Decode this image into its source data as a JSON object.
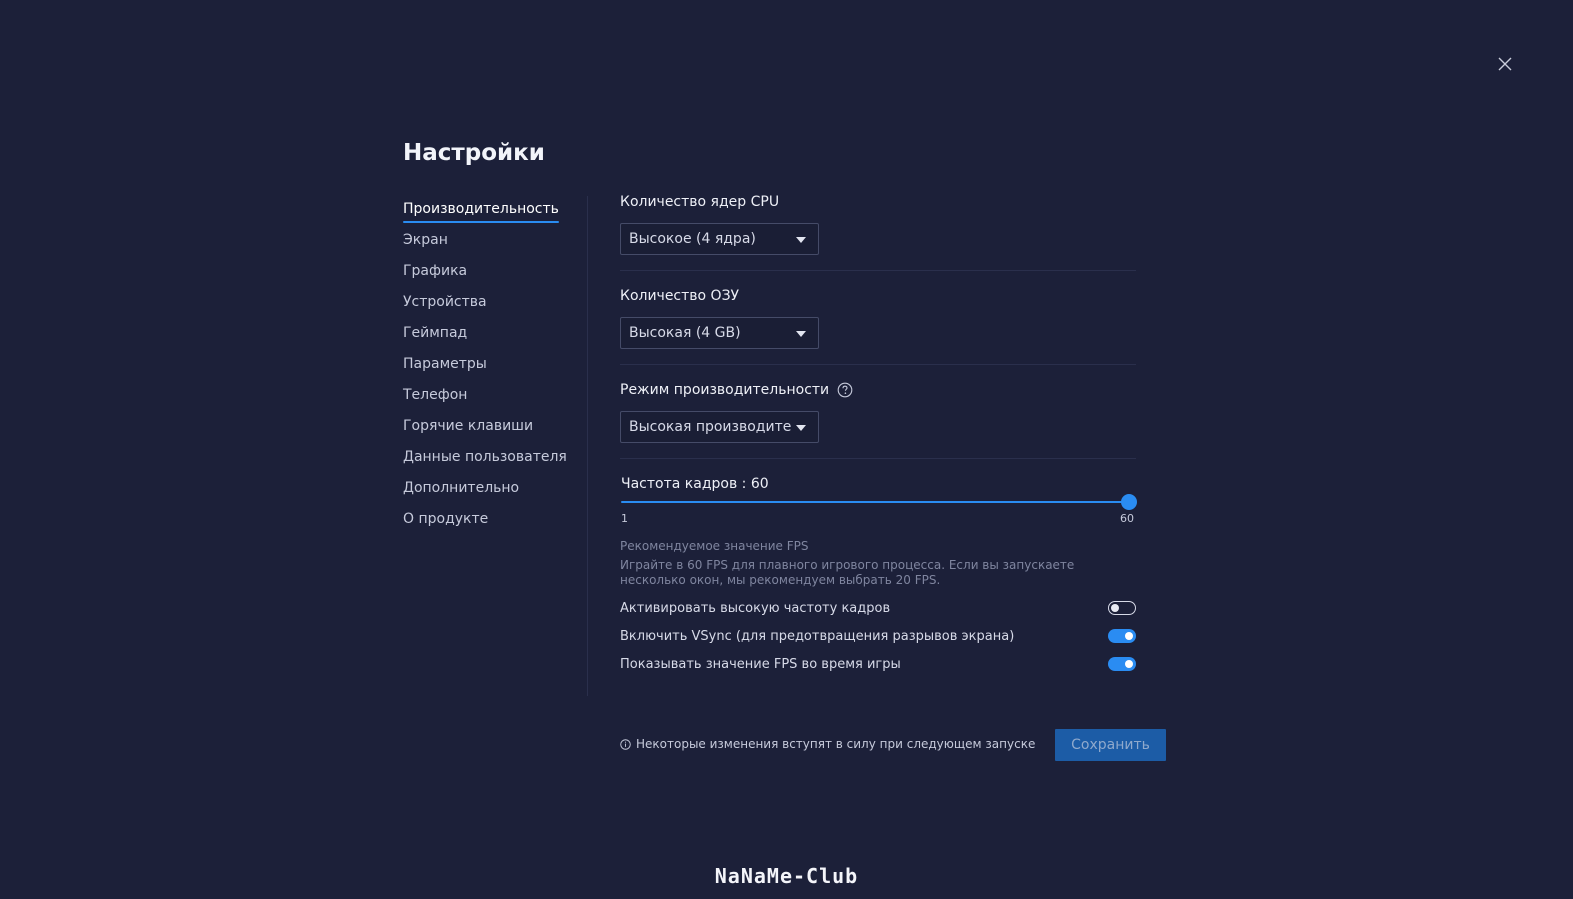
{
  "title": "Настройки",
  "close_icon": "close-icon",
  "nav": {
    "items": [
      {
        "label": "Производительность",
        "active": true
      },
      {
        "label": "Экран"
      },
      {
        "label": "Графика"
      },
      {
        "label": "Устройства"
      },
      {
        "label": "Геймпад"
      },
      {
        "label": "Параметры"
      },
      {
        "label": "Телефон"
      },
      {
        "label": "Горячие клавиши"
      },
      {
        "label": "Данные пользователя"
      },
      {
        "label": "Дополнительно"
      },
      {
        "label": "О продукте"
      }
    ]
  },
  "cpu": {
    "label": "Количество ядер CPU",
    "value": "Высокое (4 ядра)"
  },
  "ram": {
    "label": "Количество ОЗУ",
    "value": "Высокая (4 GB)"
  },
  "mode": {
    "label": "Режим производительности",
    "value": "Высокая производительность"
  },
  "fps": {
    "label": "Частота кадров : 60",
    "min_label": "1",
    "max_label": "60",
    "min": 1,
    "max": 60,
    "value": 60
  },
  "hint": {
    "title": "Рекомендуемое значение FPS",
    "text": "Играйте в 60 FPS для плавного игрового процесса. Если вы запускаете несколько окон, мы рекомендуем выбрать 20 FPS."
  },
  "toggles": [
    {
      "label": "Активировать высокую частоту кадров",
      "on": false
    },
    {
      "label": "Включить VSync (для предотвращения разрывов экрана)",
      "on": true
    },
    {
      "label": "Показывать значение FPS во время игры",
      "on": true
    }
  ],
  "note": "Некоторые изменения вступят в силу при следующем запуске",
  "save_label": "Сохранить",
  "watermark": "NaNaMe-Club",
  "colors": {
    "background": "#1c2039",
    "accent": "#2a8cf2",
    "save_button": "#1c5ca6"
  }
}
